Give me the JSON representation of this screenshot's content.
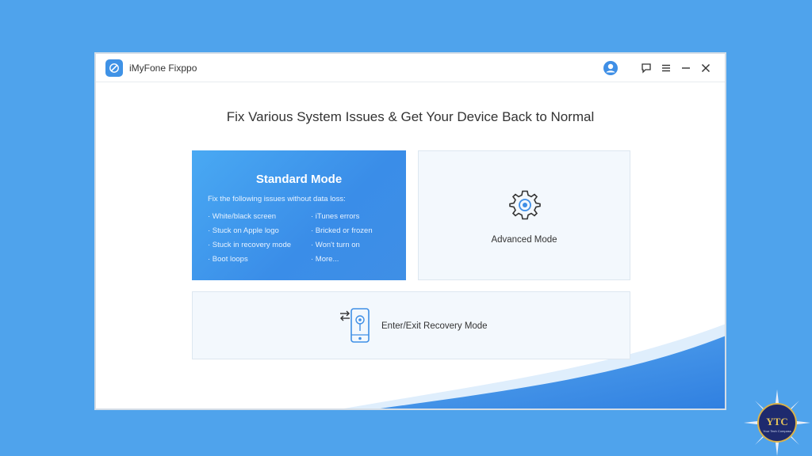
{
  "app": {
    "title": "iMyFone Fixppo",
    "logo_icon": "wrench-icon",
    "titlebar_icons": [
      "user-icon",
      "feedback-icon",
      "menu-icon",
      "minimize-icon",
      "close-icon"
    ]
  },
  "main": {
    "headline": "Fix Various System Issues & Get Your Device Back to Normal"
  },
  "standard_mode": {
    "title": "Standard Mode",
    "subtitle": "Fix the following issues without data loss:",
    "issues_left": [
      "· White/black screen",
      "· Stuck on Apple logo",
      "· Stuck in recovery mode",
      "· Boot loops"
    ],
    "issues_right": [
      "· iTunes errors",
      "· Bricked or frozen",
      "· Won't turn on",
      "· More..."
    ]
  },
  "advanced_mode": {
    "label": "Advanced Mode",
    "icon": "gear-icon"
  },
  "recovery_mode": {
    "label": "Enter/Exit Recovery Mode",
    "icon": "phone-swap-icon"
  },
  "watermark": {
    "logo_text": "YTC",
    "tagline": "Your Tech Compass"
  },
  "colors": {
    "background": "#4fa3ec",
    "accent": "#3f8fe6",
    "card_bg": "#f3f8fd"
  }
}
